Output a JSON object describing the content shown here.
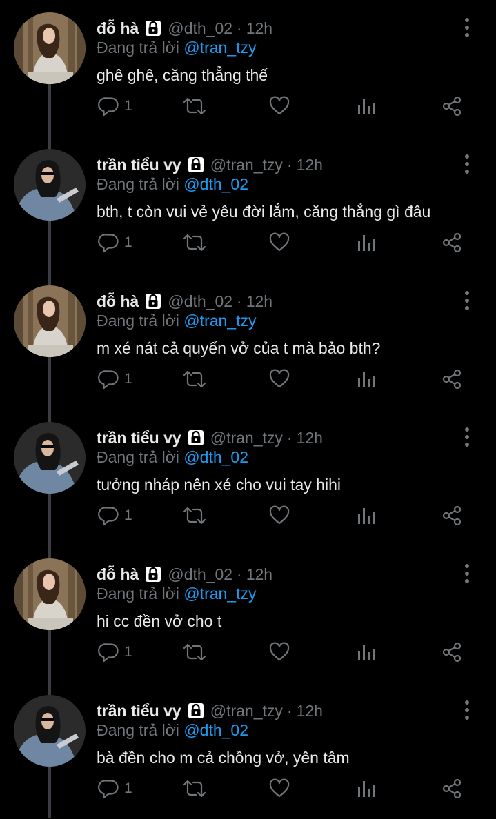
{
  "colors": {
    "background": "#000000",
    "name": "#e7e9ea",
    "secondary": "#71767b",
    "mention": "#1d9bf0",
    "thread_line": "#3a3d41"
  },
  "icons": {
    "lock": "lock-icon",
    "more": "more-vertical-icon",
    "reply": "reply-icon",
    "retweet": "retweet-icon",
    "like": "heart-icon",
    "views": "analytics-icon",
    "share": "share-icon"
  },
  "tweets": [
    {
      "name": "đỗ hà",
      "handle": "@dth_02",
      "dot": "·",
      "time": "12h",
      "reply_prefix": "Đang trả lời",
      "reply_to": "@tran_tzy",
      "text": "ghê ghê, căng thẳng thế",
      "reply_count": "1",
      "avatar": "do-ha"
    },
    {
      "name": "trần tiểu vy",
      "handle": "@tran_tzy",
      "dot": "·",
      "time": "12h",
      "reply_prefix": "Đang trả lời",
      "reply_to": "@dth_02",
      "text": "bth, t còn vui vẻ yêu đời lắm, căng thẳng gì đâu",
      "reply_count": "1",
      "avatar": "tran-tieu-vy"
    },
    {
      "name": "đỗ hà",
      "handle": "@dth_02",
      "dot": "·",
      "time": "12h",
      "reply_prefix": "Đang trả lời",
      "reply_to": "@tran_tzy",
      "text": "m xé nát cả quyển vở của t mà bảo bth?",
      "reply_count": "1",
      "avatar": "do-ha"
    },
    {
      "name": "trần tiểu vy",
      "handle": "@tran_tzy",
      "dot": "·",
      "time": "12h",
      "reply_prefix": "Đang trả lời",
      "reply_to": "@dth_02",
      "text": "tưởng nháp nên xé cho vui tay hihi",
      "reply_count": "1",
      "avatar": "tran-tieu-vy"
    },
    {
      "name": "đỗ hà",
      "handle": "@dth_02",
      "dot": "·",
      "time": "12h",
      "reply_prefix": "Đang trả lời",
      "reply_to": "@tran_tzy",
      "text": "hi cc đền vở cho t",
      "reply_count": "1",
      "avatar": "do-ha"
    },
    {
      "name": "trần tiểu vy",
      "handle": "@tran_tzy",
      "dot": "·",
      "time": "12h",
      "reply_prefix": "Đang trả lời",
      "reply_to": "@dth_02",
      "text": "bà đền cho m cả chồng vở, yên tâm",
      "reply_count": "1",
      "avatar": "tran-tieu-vy"
    }
  ]
}
